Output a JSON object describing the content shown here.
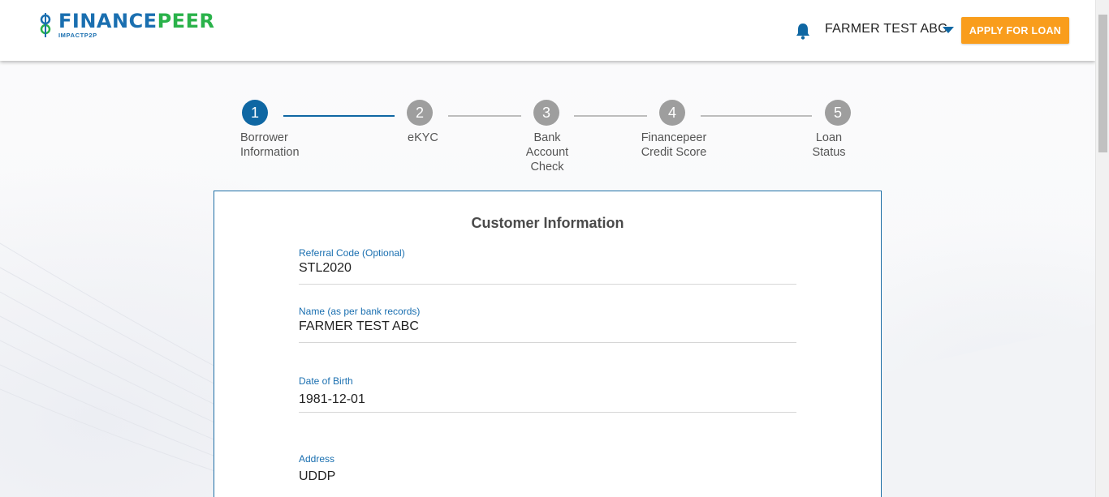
{
  "header": {
    "logo_main_left": "FINANCE",
    "logo_main_right": "PEER",
    "logo_sub": "IMPACTP2P",
    "user_name": "FARMER TEST ABC",
    "apply_button": "APPLY FOR LOAN"
  },
  "stepper": {
    "steps": [
      {
        "number": "1",
        "line1": "Borrower",
        "line2": "Information",
        "line3": "",
        "state": "active"
      },
      {
        "number": "2",
        "line1": "eKYC",
        "line2": "",
        "line3": "",
        "state": "inactive"
      },
      {
        "number": "3",
        "line1": "Bank",
        "line2": "Account",
        "line3": "Check",
        "state": "inactive"
      },
      {
        "number": "4",
        "line1": "Financepeer",
        "line2": "Credit Score",
        "line3": "",
        "state": "inactive"
      },
      {
        "number": "5",
        "line1": "Loan",
        "line2": "Status",
        "line3": "",
        "state": "inactive"
      }
    ]
  },
  "form": {
    "title": "Customer Information",
    "fields": [
      {
        "label": "Referral Code (Optional)",
        "value": "STL2020"
      },
      {
        "label": "Name (as per bank records)",
        "value": "FARMER TEST ABC"
      },
      {
        "label": "Date of Birth",
        "value": "1981-12-01"
      },
      {
        "label": "Address",
        "value": "UDDP"
      }
    ]
  },
  "colors": {
    "primary": "#0f67a3",
    "accent": "#f99d1c",
    "brand_green": "#2ab24a",
    "inactive_step": "#9e9e9e"
  },
  "icons": {
    "bell": "bell-icon",
    "dropdown": "caret-down-icon",
    "logo": "financepeer-logo-icon"
  }
}
